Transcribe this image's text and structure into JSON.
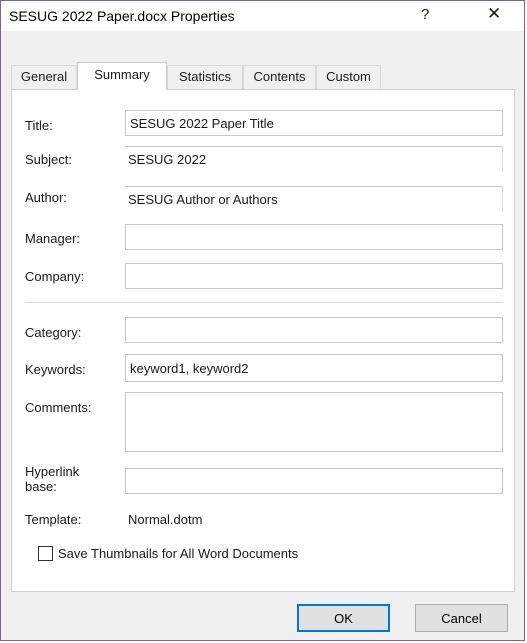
{
  "window": {
    "title": "SESUG 2022 Paper.docx Properties",
    "help_glyph": "?",
    "close_glyph": "✕"
  },
  "tabs": [
    {
      "label": "General"
    },
    {
      "label": "Summary",
      "active": true
    },
    {
      "label": "Statistics"
    },
    {
      "label": "Contents"
    },
    {
      "label": "Custom"
    }
  ],
  "summary": {
    "title_label": "Title:",
    "title_value": "SESUG 2022 Paper Title",
    "subject_label": "Subject:",
    "subject_value": "SESUG 2022",
    "author_label": "Author:",
    "author_value": "SESUG Author or Authors",
    "manager_label": "Manager:",
    "manager_value": "",
    "company_label": "Company:",
    "company_value": "",
    "category_label": "Category:",
    "category_value": "",
    "keywords_label": "Keywords:",
    "keywords_value": "keyword1, keyword2",
    "comments_label": "Comments:",
    "comments_value": "",
    "hyperlink_label_line1": "Hyperlink",
    "hyperlink_label_line2": "base:",
    "hyperlink_value": "",
    "template_label": "Template:",
    "template_value": "Normal.dotm",
    "thumbnail_label": "Save Thumbnails for All Word Documents",
    "thumbnail_checked": false
  },
  "buttons": {
    "ok": "OK",
    "cancel": "Cancel"
  },
  "colors": {
    "window_border": "#7b5ea7",
    "dialog_bg": "#f0f0f0",
    "panel_bg": "#ffffff",
    "default_button_border": "#0078d7"
  }
}
